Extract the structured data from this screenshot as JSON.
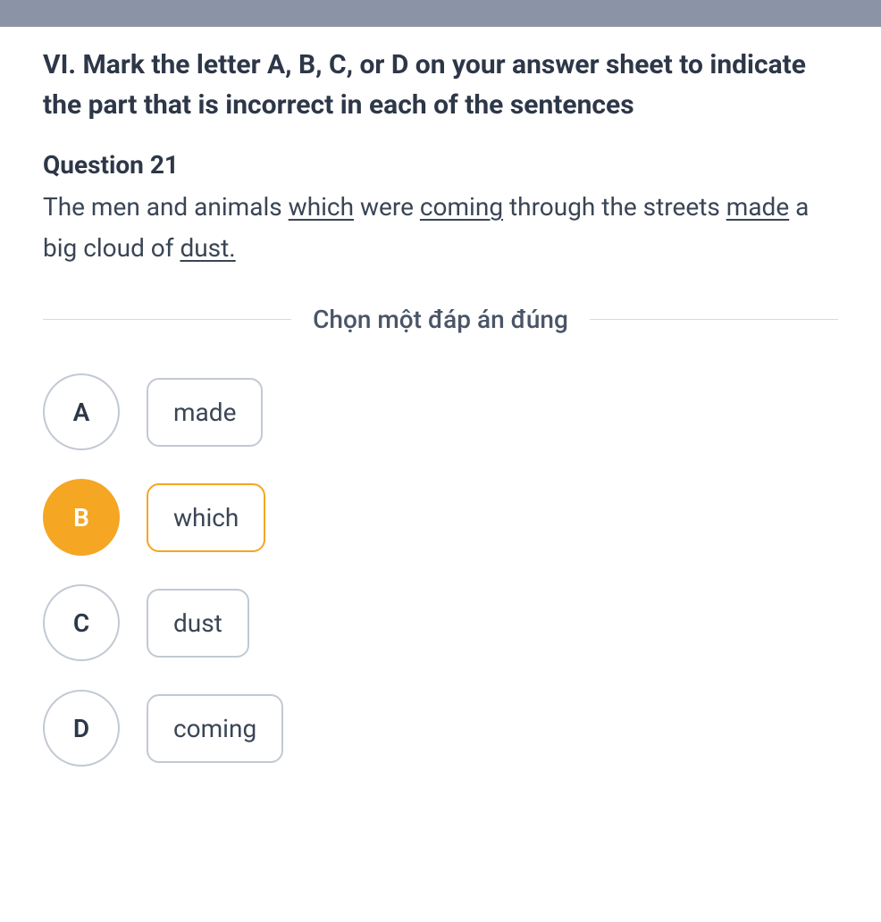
{
  "section_title": "VI. Mark the letter A, B, C, or D on your answer sheet to indicate the part that is incorrect in each of the sentences",
  "question_label": "Question 21",
  "question_sentence": {
    "part1": "The men and animals ",
    "underlined1": "which",
    "part2": " were ",
    "underlined2": "coming",
    "part3": " through the streets ",
    "underlined3": "made",
    "part4": " a big cloud of ",
    "underlined4": "dust.",
    "part5": ""
  },
  "divider_text": "Chọn một đáp án đúng",
  "options": [
    {
      "letter": "A",
      "text": "made",
      "selected": false
    },
    {
      "letter": "B",
      "text": "which",
      "selected": true
    },
    {
      "letter": "C",
      "text": "dust",
      "selected": false
    },
    {
      "letter": "D",
      "text": "coming",
      "selected": false
    }
  ]
}
